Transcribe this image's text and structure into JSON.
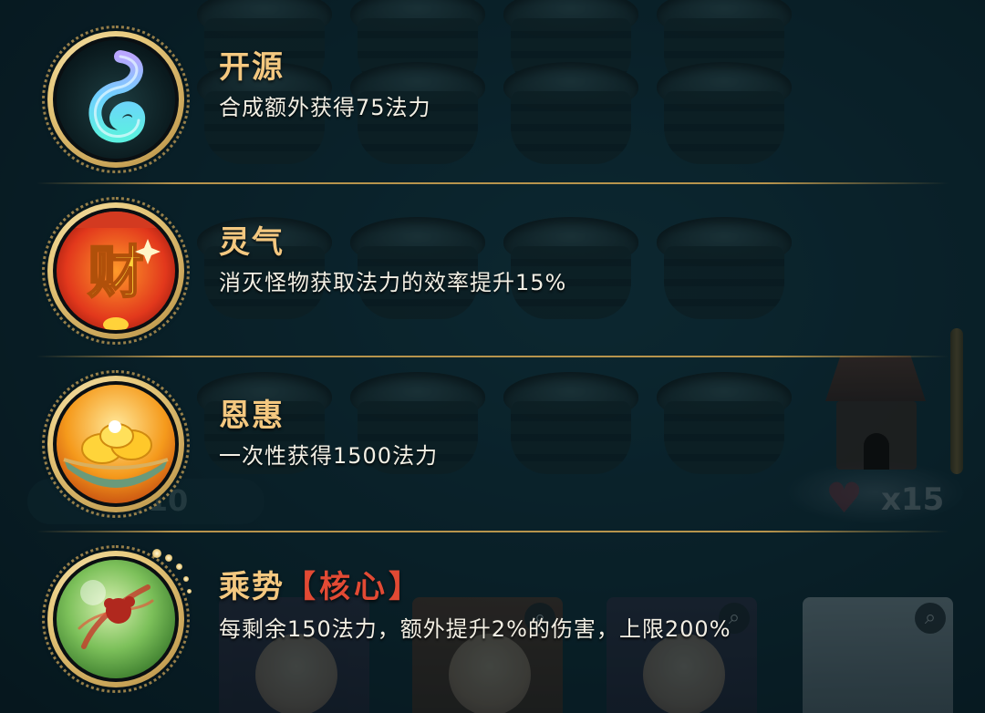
{
  "background": {
    "heart_count": "x15",
    "counter_text": "/10"
  },
  "talents": [
    {
      "title": "开源",
      "core_tag": "",
      "description": "合成额外获得75法力",
      "icon": "blue-spirit-wisp-icon"
    },
    {
      "title": "灵气",
      "core_tag": "",
      "description": "消灭怪物获取法力的效率提升15%",
      "icon": "fortune-cai-lantern-icon"
    },
    {
      "title": "恩惠",
      "core_tag": "",
      "description": "一次性获得1500法力",
      "icon": "gold-treasure-bowl-icon"
    },
    {
      "title": "乘势",
      "core_tag": "【核心】",
      "description": "每剩余150法力，额外提升2%的伤害，上限200%",
      "icon": "green-orb-red-dragon-icon"
    }
  ],
  "colors": {
    "title": "#f4c880",
    "core_tag": "#e24a34",
    "description": "#f3efe4",
    "divider": "#caa050"
  }
}
